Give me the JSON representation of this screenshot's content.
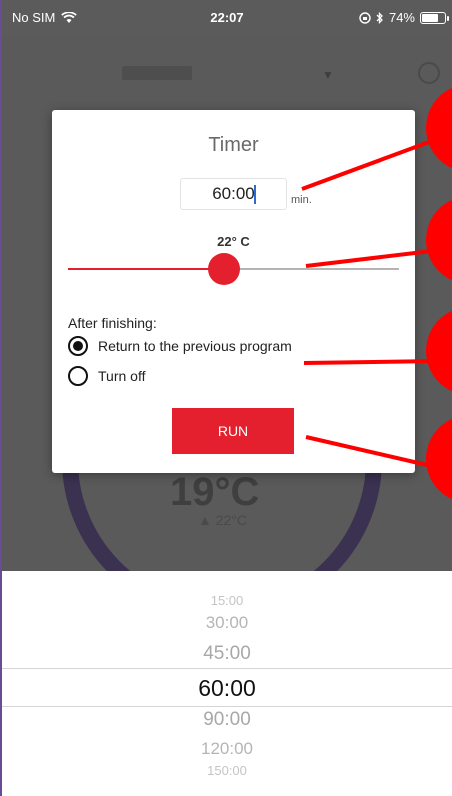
{
  "status_bar": {
    "carrier": "No SIM",
    "time": "22:07",
    "battery": "74%",
    "battery_level": 0.74
  },
  "dialog": {
    "title": "Timer",
    "timer_value": "60:00",
    "timer_unit": "min.",
    "temperature": "22° C",
    "slider_fraction": 0.47,
    "after_label": "After finishing:",
    "options": [
      {
        "label": "Return to the previous program",
        "checked": true
      },
      {
        "label": "Turn off",
        "checked": false
      }
    ],
    "run_label": "RUN"
  },
  "picker": {
    "items": [
      "15:00",
      "30:00",
      "45:00",
      "60:00",
      "90:00",
      "120:00",
      "150:00"
    ],
    "selected": "60:00"
  },
  "colors": {
    "accent": "#e4202e",
    "callout": "#ff0000",
    "overlay": "#5a5a5a"
  }
}
